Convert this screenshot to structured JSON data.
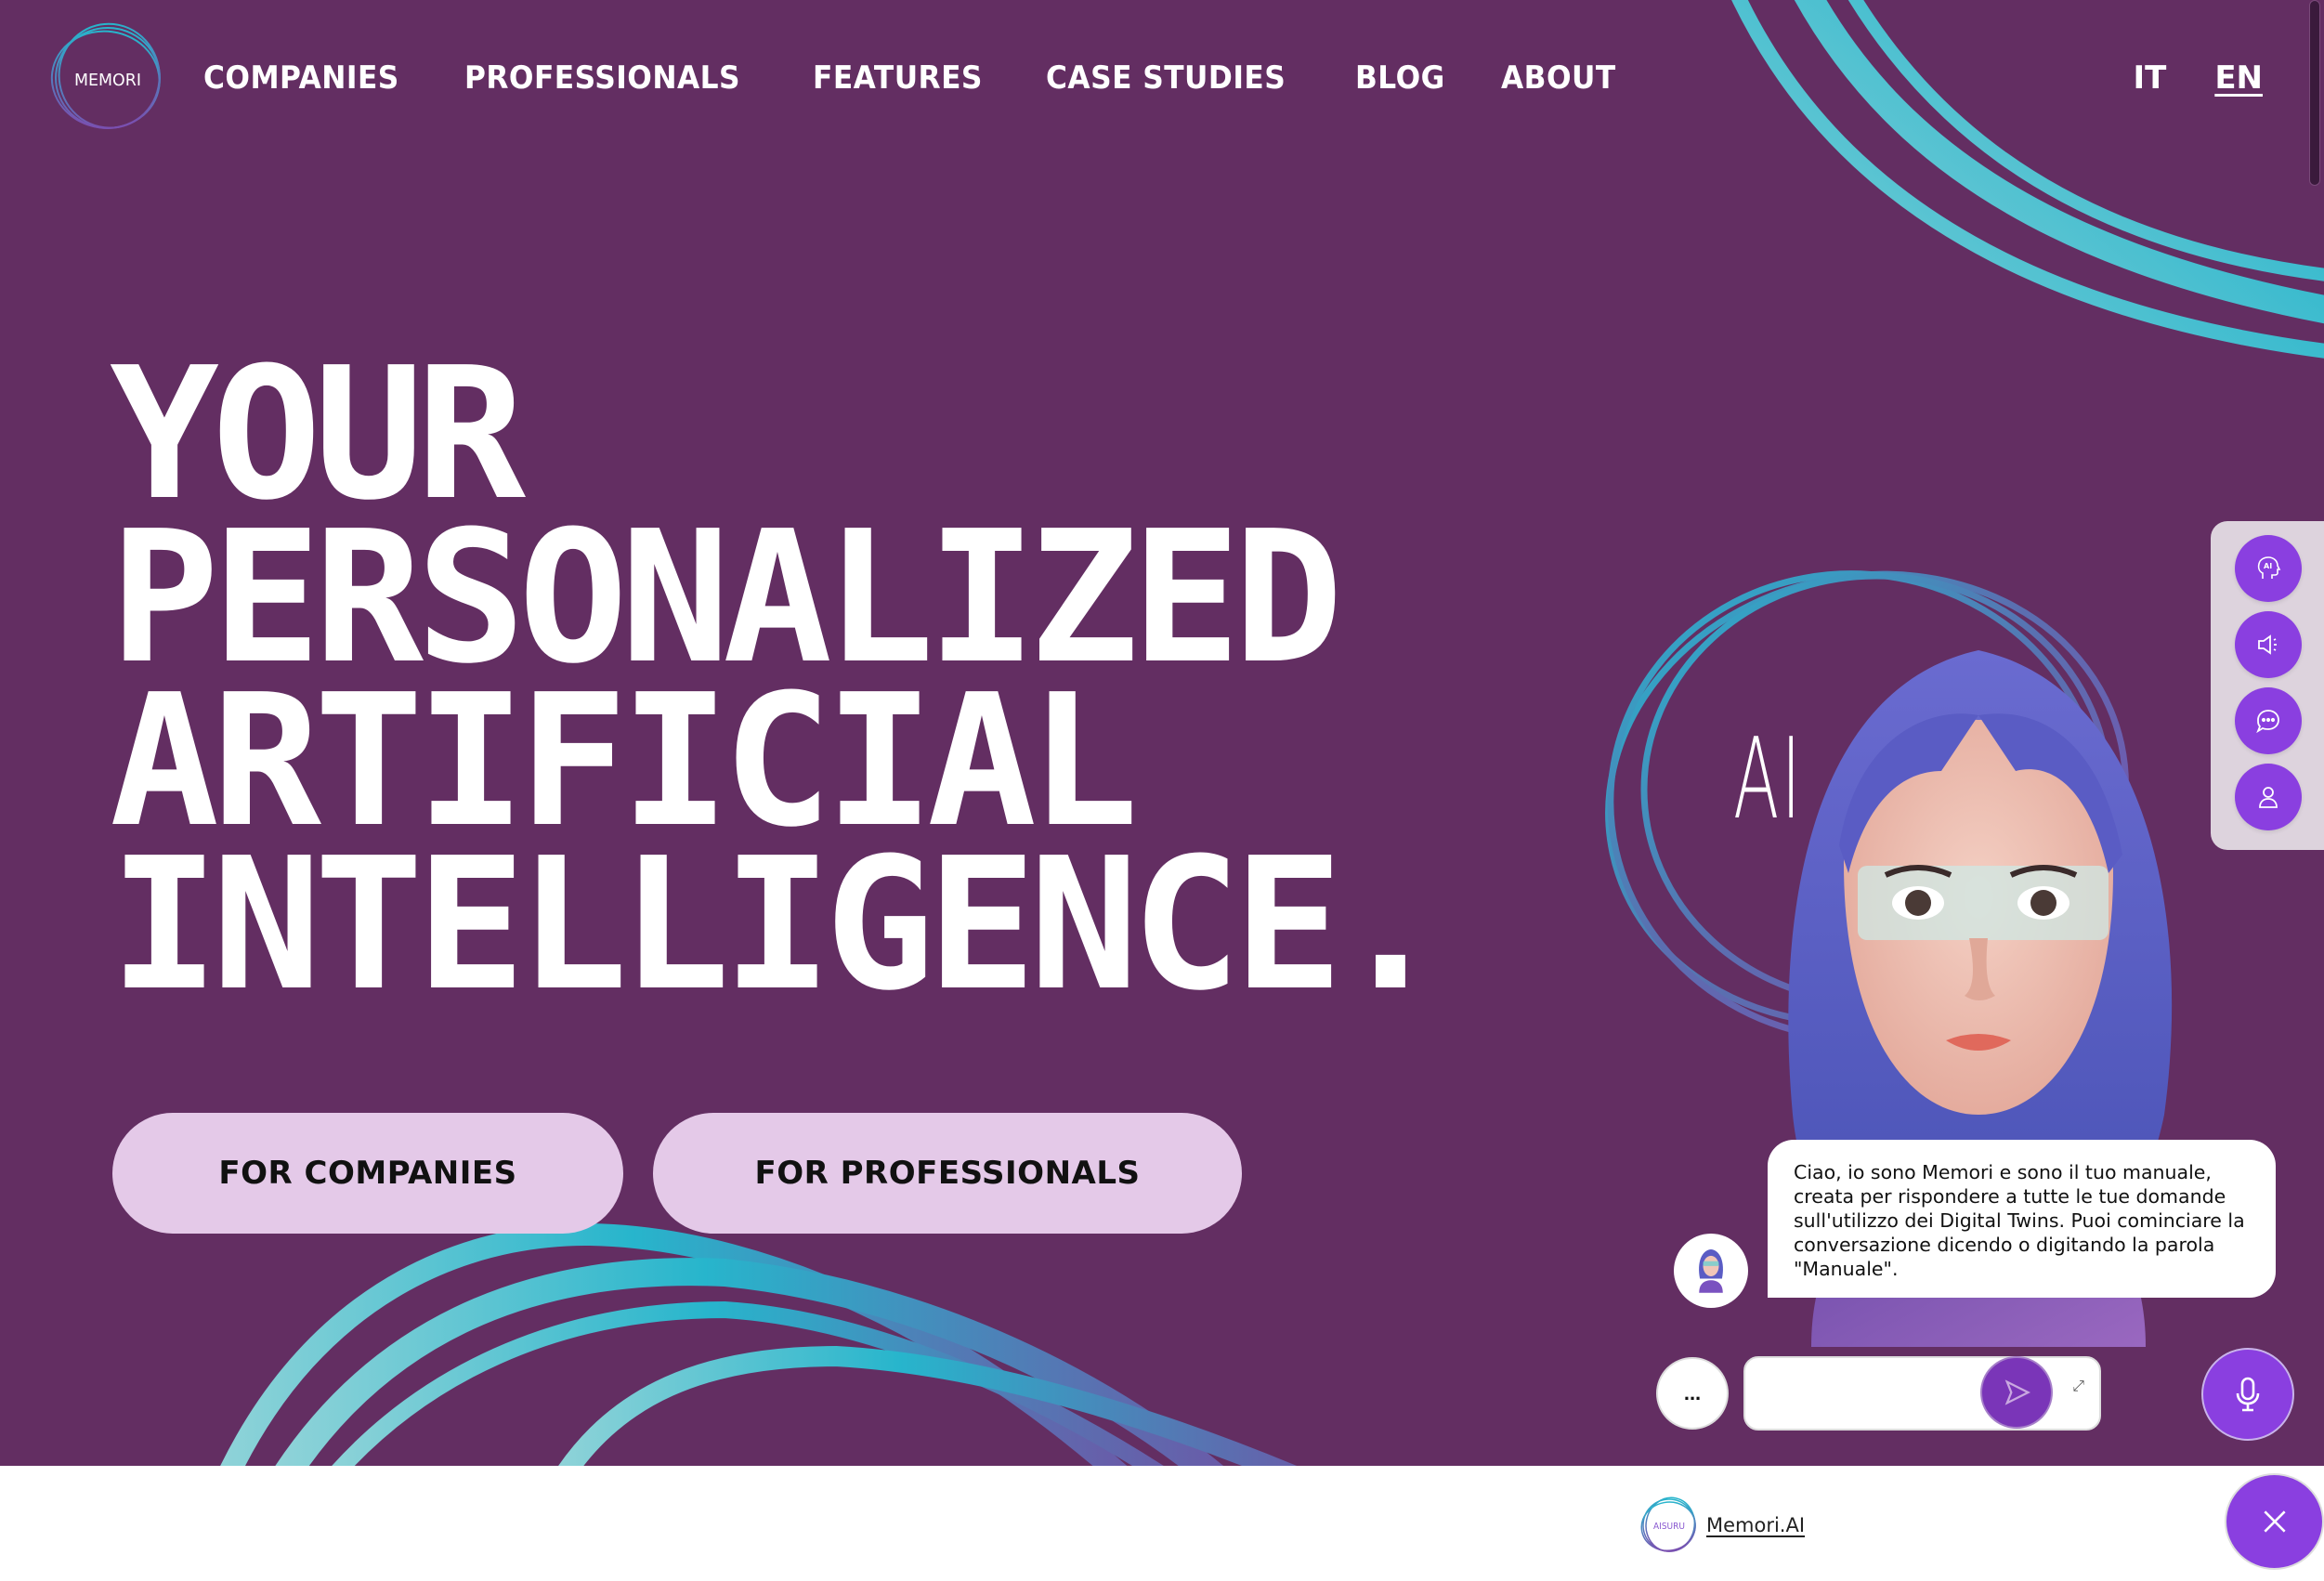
{
  "brand": {
    "logo_text": "MEMORI",
    "bg_color": "#632e62",
    "accent": "#8a3fe0",
    "cta_bg": "#e4c9e8",
    "swirl_cyan": "#27b5cc"
  },
  "nav": {
    "items": [
      {
        "label": "COMPANIES"
      },
      {
        "label": "PROFESSIONALS"
      },
      {
        "label": "FEATURES"
      },
      {
        "label": "CASE STUDIES"
      },
      {
        "label": "BLOG"
      },
      {
        "label": "ABOUT"
      }
    ]
  },
  "languages": {
    "items": [
      {
        "label": "IT"
      },
      {
        "label": "EN",
        "active": true
      }
    ]
  },
  "hero": {
    "lines": [
      "YOUR",
      "PERSONALIZED",
      "ARTIFICIAL",
      "INTELLIGENCE."
    ],
    "buttons": {
      "companies": "FOR COMPANIES",
      "professionals": "FOR PROFESSIONALS"
    },
    "ring_text": "AI"
  },
  "side_panel": {
    "buttons": [
      {
        "icon": "ai-head-icon"
      },
      {
        "icon": "speaker-icon"
      },
      {
        "icon": "chat-bubble-icon"
      },
      {
        "icon": "user-icon"
      }
    ]
  },
  "chat": {
    "message": "Ciao, io sono Memori e sono il tuo manuale, creata per rispondere a tutte le tue domande sull'utilizzo dei Digital Twins. Puoi cominciare la conversazione dicendo o digitando la parola \"Manuale\".",
    "more_label": "...",
    "input_value": "",
    "input_placeholder": ""
  },
  "footer": {
    "powered_logo_text": "AISURU",
    "powered_link": "Memori.AI"
  }
}
